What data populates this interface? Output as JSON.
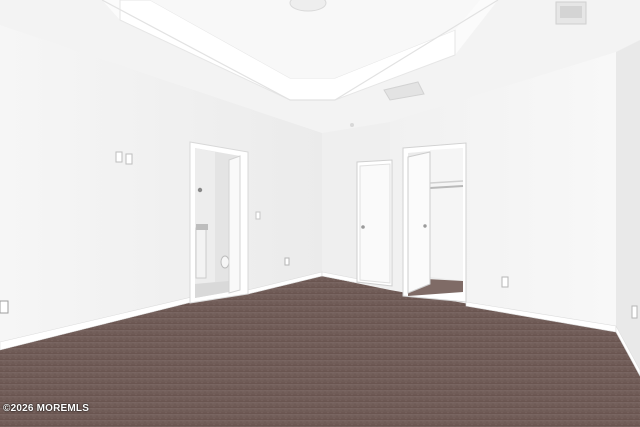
{
  "photo": {
    "watermark": "©2026 MOREMLS"
  },
  "colors": {
    "wall": "#f4f4f4",
    "ceiling": "#f7f7f7",
    "carpet": "#6f5a55",
    "trim": "#ffffff"
  }
}
